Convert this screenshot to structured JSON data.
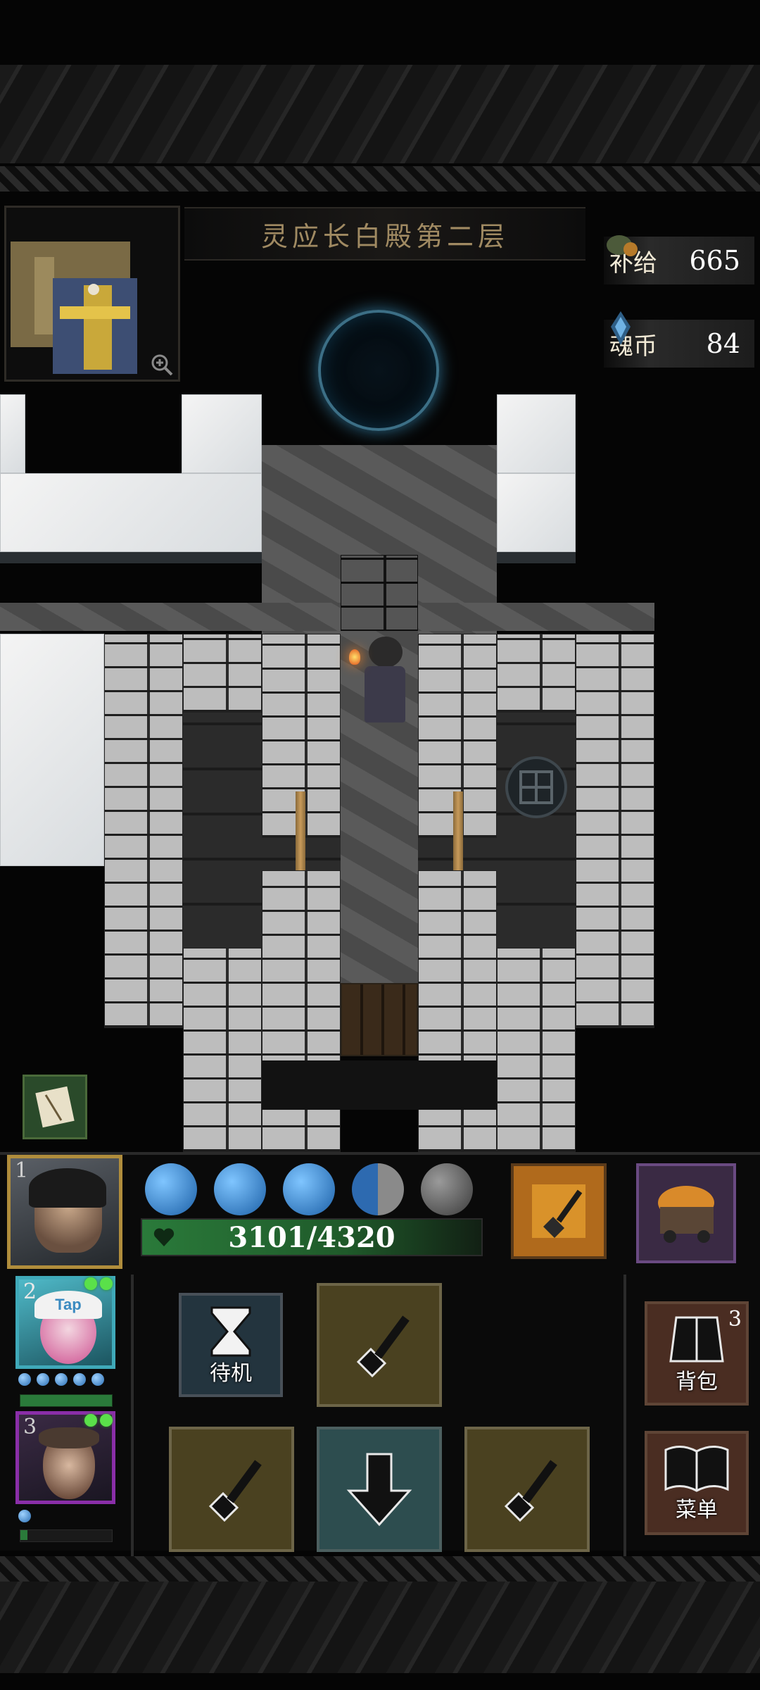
{
  "floor_title": "灵应长白殿第二层",
  "currency": {
    "supply_label": "补给",
    "supply_value": "665",
    "soul_label": "魂币",
    "soul_value": "84"
  },
  "party": {
    "active_slot": "1",
    "hp_text": "3101/4320",
    "spirit_orbs_total": 5,
    "spirit_orbs_full": 3,
    "members": [
      {
        "slot": "1"
      },
      {
        "slot": "2",
        "cap_text": "Tap"
      },
      {
        "slot": "3"
      }
    ]
  },
  "actions": {
    "standby_label": "待机",
    "backpack_label": "背包",
    "backpack_count": "3",
    "menu_label": "菜单"
  },
  "colors": {
    "accent_gold": "#b08d3c",
    "hp_green": "#2a7a3a",
    "slot2_frame": "#3fa9b9",
    "slot3_frame": "#8a2ea8"
  }
}
